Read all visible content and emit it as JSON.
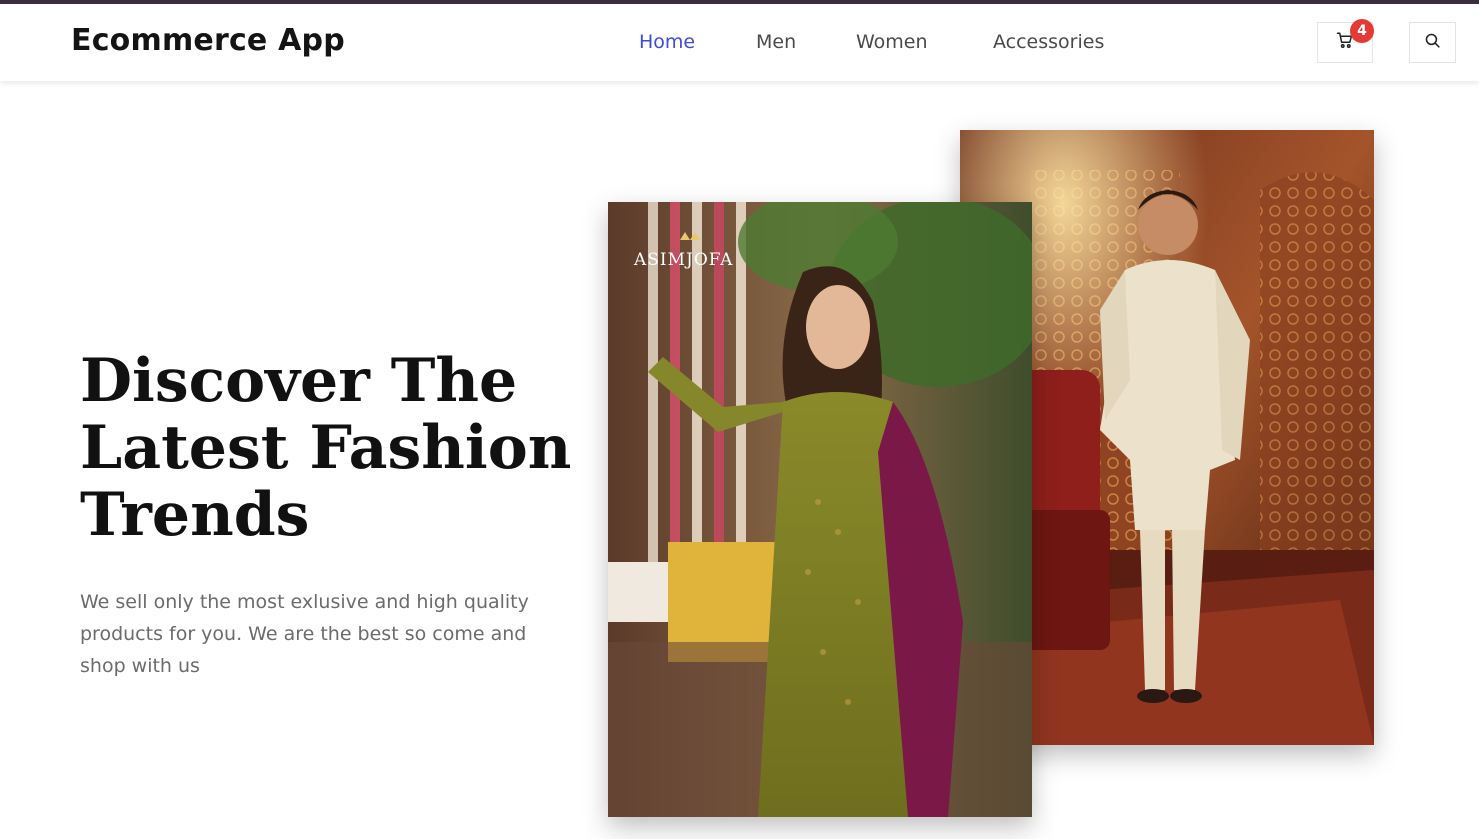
{
  "header": {
    "brand": "Ecommerce App",
    "nav": [
      {
        "label": "Home",
        "active": true
      },
      {
        "label": "Men",
        "active": false
      },
      {
        "label": "Women",
        "active": false
      },
      {
        "label": "Accessories",
        "active": false
      }
    ],
    "cart": {
      "icon": "cart-icon",
      "count": "4"
    },
    "search": {
      "icon": "search-icon"
    }
  },
  "hero": {
    "title_lines": [
      "Discover The",
      "Latest Fashion",
      "Trends"
    ],
    "description": "We sell only the most exlusive and high quality products for you. We are the best so come and shop with us"
  },
  "images": {
    "women": {
      "logo_text": "ASIMJOFA"
    },
    "men": {}
  },
  "colors": {
    "accent": "#3d4bd6",
    "badge": "#e53935",
    "text": "#111111",
    "muted": "#6b6b6b"
  }
}
